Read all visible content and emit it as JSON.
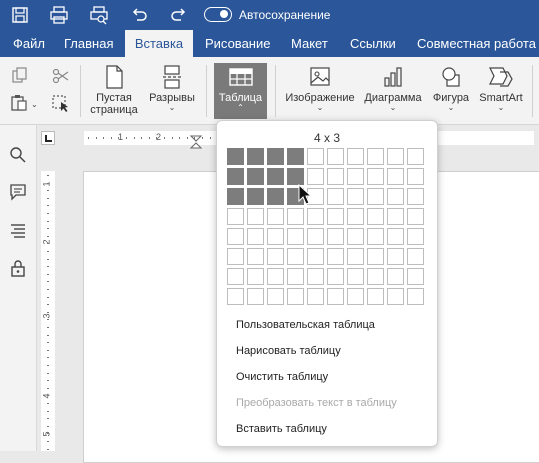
{
  "autosave": {
    "label": "Автосохранение",
    "on": true
  },
  "tabs": [
    "Файл",
    "Главная",
    "Вставка",
    "Рисование",
    "Макет",
    "Ссылки",
    "Совместная работа"
  ],
  "active_tab": "Вставка",
  "ribbon": {
    "blank_page": {
      "line1": "Пустая",
      "line2": "страница"
    },
    "breaks": "Разрывы",
    "table": "Таблица",
    "image": "Изображение",
    "chart": "Диаграмма",
    "shape": "Фигура",
    "smartart": "SmartArt"
  },
  "ruler": {
    "h_ticks": [
      "1",
      "2"
    ],
    "v_ticks": [
      "1",
      "2",
      "3",
      "4",
      "5"
    ]
  },
  "table_picker": {
    "label": "4 x 3",
    "grid_columns": 10,
    "grid_rows": 8,
    "selected_columns": 4,
    "selected_rows": 3
  },
  "menu": {
    "custom_table": "Пользовательская таблица",
    "draw_table": "Нарисовать таблицу",
    "clear_table": "Очистить таблицу",
    "convert_text": "Преобразовать текст в таблицу",
    "insert_table": "Вставить таблицу"
  },
  "colors": {
    "accent": "#2b579a",
    "selected_cell": "#7d7d7d",
    "active_button": "#7a7a7a"
  }
}
